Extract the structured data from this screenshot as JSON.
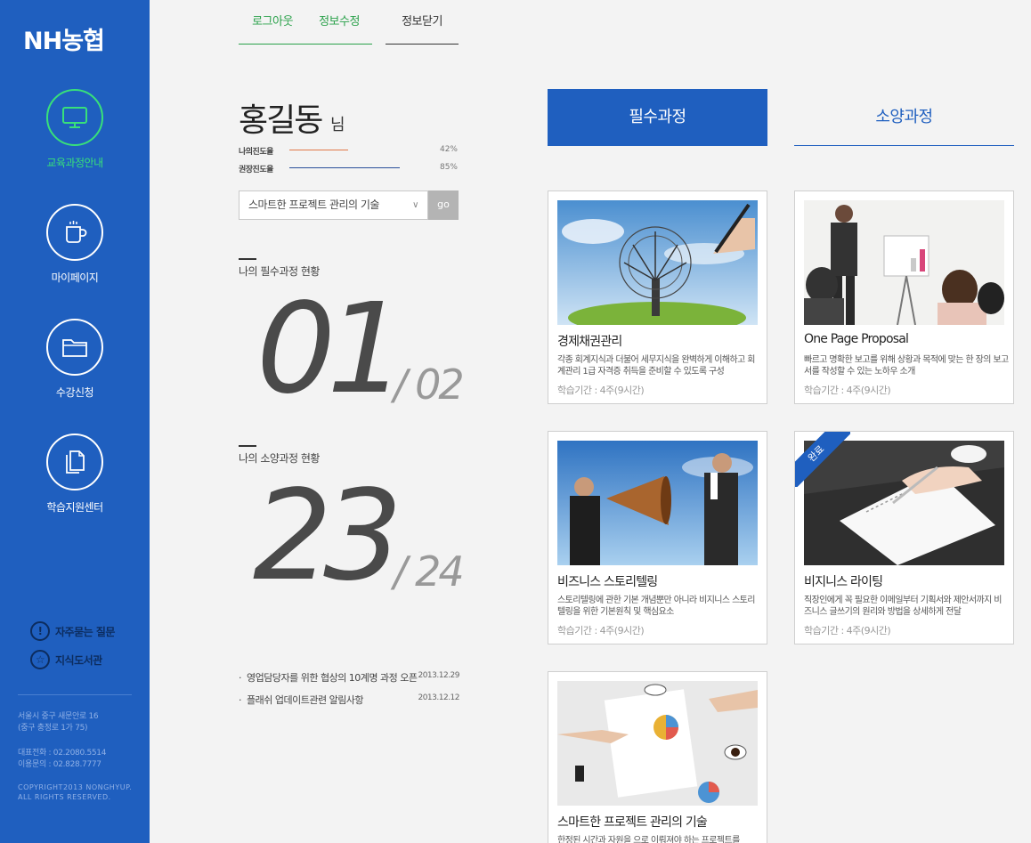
{
  "sidebar": {
    "logo": "NH농협",
    "nav": [
      {
        "label": "교육과정안내",
        "icon": "monitor-icon",
        "active": true
      },
      {
        "label": "마이페이지",
        "icon": "cup-icon",
        "active": false
      },
      {
        "label": "수강신청",
        "icon": "folder-icon",
        "active": false
      },
      {
        "label": "학습지원센터",
        "icon": "document-icon",
        "active": false
      }
    ],
    "links": [
      {
        "label": "자주묻는 질문",
        "icon": "exclamation-icon",
        "glyph": "!"
      },
      {
        "label": "지식도서관",
        "icon": "star-icon",
        "glyph": "☆"
      }
    ],
    "address": [
      "서울시 중구 새문안로 16",
      "(중구 충정로 1가 75)"
    ],
    "phones": [
      "대표전화 : 02.2080.5514",
      "이용문의 : 02.828.7777"
    ],
    "copyright": [
      "COPYRIGHT2013 NONGHYUP.",
      "ALL RIGHTS RESERVED."
    ],
    "colors": {
      "background": "#1f5fbf",
      "active": "#38e07a"
    }
  },
  "top_links": {
    "logout": "로그아웃",
    "edit_info": "정보수정",
    "close_info": "정보닫기"
  },
  "profile": {
    "name": "홍길동",
    "suffix": "님",
    "my_progress_label": "나의진도율",
    "my_progress_pct": "42%",
    "my_progress_value": 42,
    "recommended_progress_label": "권장진도율",
    "recommended_progress_pct": "85%",
    "recommended_progress_value": 85
  },
  "course_select": {
    "selected": "스마트한 프로젝트 관리의 기술",
    "go_label": "go"
  },
  "status": {
    "required_title": "나의 필수과정 현황",
    "required_done": "01",
    "required_total": "/ 02",
    "culture_title": "나의 소양과정 현황",
    "culture_done": "23",
    "culture_total": "/ 24"
  },
  "notices": [
    {
      "text": "영업담당자를 위한 협상의 10계명 과정 오픈",
      "date": "2013.12.29"
    },
    {
      "text": "플래쉬 업데이트관련 알림사항",
      "date": "2013.12.12"
    }
  ],
  "tabs": {
    "required": "필수과정",
    "culture": "소양과정"
  },
  "courses": [
    {
      "title": "경제채권관리",
      "desc": "각종 회계지식과 더불어 세무지식을 완벽하게 이해하고 회계관리 1급 자격증 취득을 준비할 수 있도록 구성",
      "period": "학습기간 : 4주(9시간)",
      "image": "tree-drawing-image"
    },
    {
      "title": "One Page Proposal",
      "desc": "빠르고 명확한 보고를 위해 상황과 목적에 맞는 한 장의 보고서를 작성할 수 있는 노하우 소개",
      "period": "학습기간 : 4주(9시간)",
      "image": "presentation-meeting-image"
    },
    {
      "title": "비즈니스 스토리텔링",
      "desc": "스토리텔링에 관한 기본 개념뿐만 아니라 비지니스 스토리텔링을 위한 기본원칙 및 핵심요소",
      "period": "학습기간 : 4주(9시간)",
      "image": "megaphone-businessmen-image"
    },
    {
      "title": "비지니스 라이팅",
      "desc": "직장인에게 꼭 필요한 이메일부터 기획서와 제안서까지 비즈니스 글쓰기의 원리와 방법을 상세하게 전달",
      "period": "학습기간 : 4주(9시간)",
      "image": "writing-notebook-image",
      "badge": "완료"
    },
    {
      "title": "스마트한 프로젝트 관리의 기술",
      "desc": "한정된 시간과 자원을 으로 이뤄져야 하는 프로젝트를",
      "period": "",
      "image": "charts-meeting-image"
    }
  ]
}
